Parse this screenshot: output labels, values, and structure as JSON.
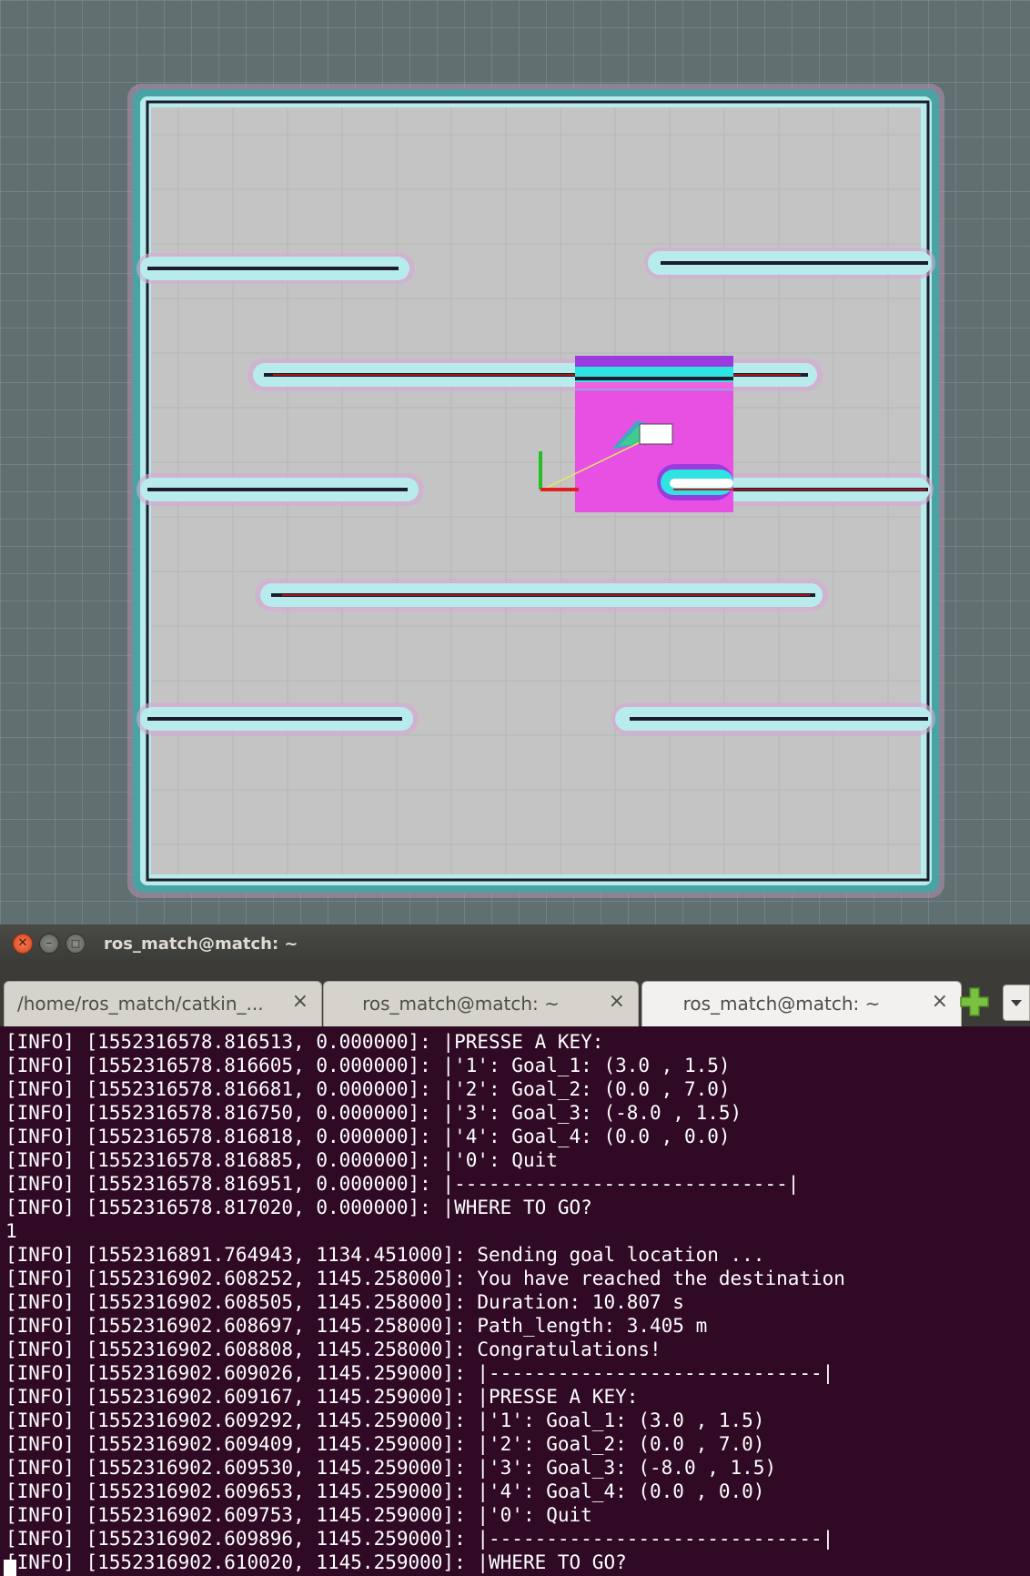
{
  "rviz": {
    "background_color": "#607070",
    "grid_color": "#8fa0a0",
    "map_free_color": "#c4c4c4",
    "inflation_color": "#b8ecec",
    "inscribed_color": "#4aa3a3",
    "local_costmap_color": "#f060e0",
    "robot_color": "#ffffff",
    "axes": [
      "x-axis-red",
      "y-axis-green"
    ]
  },
  "window": {
    "title": "ros_match@match: ~",
    "buttons": [
      "close-icon",
      "minimize-icon",
      "maximize-icon"
    ]
  },
  "tabs": [
    {
      "label": "/home/ros_match/catkin_...",
      "close": "×"
    },
    {
      "label": "ros_match@match: ~",
      "close": "×"
    },
    {
      "label": "ros_match@match: ~",
      "close": "×",
      "active": true
    }
  ],
  "toolbar": {
    "new_tab_icon": "plus-icon",
    "menu_icon": "chevron-down-icon"
  },
  "terminal": {
    "background": "#300a24",
    "foreground": "#ffffff",
    "lines": [
      "[INFO] [1552316578.816513, 0.000000]: |PRESSE A KEY:",
      "[INFO] [1552316578.816605, 0.000000]: |'1': Goal_1: (3.0 , 1.5)",
      "[INFO] [1552316578.816681, 0.000000]: |'2': Goal_2: (0.0 , 7.0)",
      "[INFO] [1552316578.816750, 0.000000]: |'3': Goal_3: (-8.0 , 1.5)",
      "[INFO] [1552316578.816818, 0.000000]: |'4': Goal_4: (0.0 , 0.0)",
      "[INFO] [1552316578.816885, 0.000000]: |'0': Quit",
      "[INFO] [1552316578.816951, 0.000000]: |-----------------------------|",
      "[INFO] [1552316578.817020, 0.000000]: |WHERE TO GO?",
      "1",
      "[INFO] [1552316891.764943, 1134.451000]: Sending goal location ...",
      "[INFO] [1552316902.608252, 1145.258000]: You have reached the destination",
      "[INFO] [1552316902.608505, 1145.258000]: Duration: 10.807 s",
      "[INFO] [1552316902.608697, 1145.258000]: Path_length: 3.405 m",
      "[INFO] [1552316902.608808, 1145.258000]: Congratulations!",
      "[INFO] [1552316902.609026, 1145.259000]: |-----------------------------|",
      "[INFO] [1552316902.609167, 1145.259000]: |PRESSE A KEY:",
      "[INFO] [1552316902.609292, 1145.259000]: |'1': Goal_1: (3.0 , 1.5)",
      "[INFO] [1552316902.609409, 1145.259000]: |'2': Goal_2: (0.0 , 7.0)",
      "[INFO] [1552316902.609530, 1145.259000]: |'3': Goal_3: (-8.0 , 1.5)",
      "[INFO] [1552316902.609653, 1145.259000]: |'4': Goal_4: (0.0 , 0.0)",
      "[INFO] [1552316902.609753, 1145.259000]: |'0': Quit",
      "[INFO] [1552316902.609896, 1145.259000]: |-----------------------------|",
      "[INFO] [1552316902.610020, 1145.259000]: |WHERE TO GO?"
    ]
  }
}
